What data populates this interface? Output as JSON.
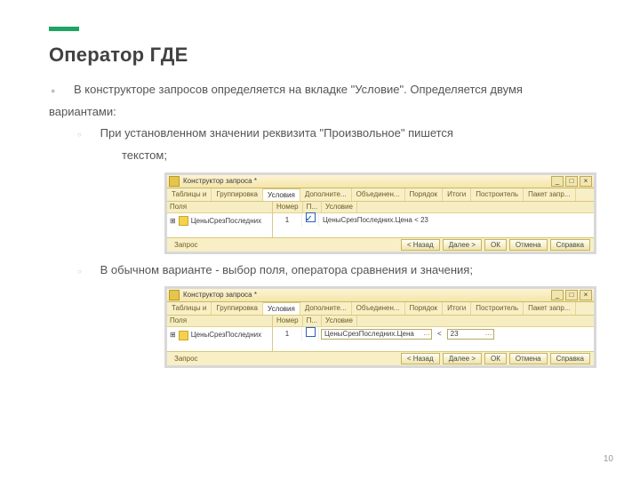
{
  "page_number": "10",
  "heading": "Оператор ГДЕ",
  "bullets": {
    "main": "В конструкторе запросов определяется на вкладке \"Условие\". Определяется двумя вариантами:",
    "sub1a": "При установленном значении реквизита \"Произвольное\" пишется",
    "sub1b": "текстом;",
    "sub2": "В обычном варианте - выбор поля, оператора сравнения и значения;"
  },
  "window": {
    "title": "Конструктор запроса *",
    "tabs": [
      "Таблицы и",
      "Группировка",
      "Условия",
      "Дополните...",
      "Объединен...",
      "Порядок",
      "Итоги",
      "Построитель",
      "Пакет запр..."
    ],
    "left_header": "Поля",
    "left_field": "ЦеныСрезПоследних",
    "right_headers": {
      "n": "Номер",
      "c": "П...",
      "cond": "Условие"
    },
    "row_number": "1",
    "cond_text": "ЦеныСрезПоследних.Цена < 23",
    "cond_field": "ЦеныСрезПоследних.Цена",
    "cond_op": "<",
    "cond_val": "23",
    "status_left": "Запрос",
    "buttons": {
      "back": "< Назад",
      "next": "Далее >",
      "ok": "ОК",
      "cancel": "Отмена",
      "help": "Справка"
    }
  }
}
